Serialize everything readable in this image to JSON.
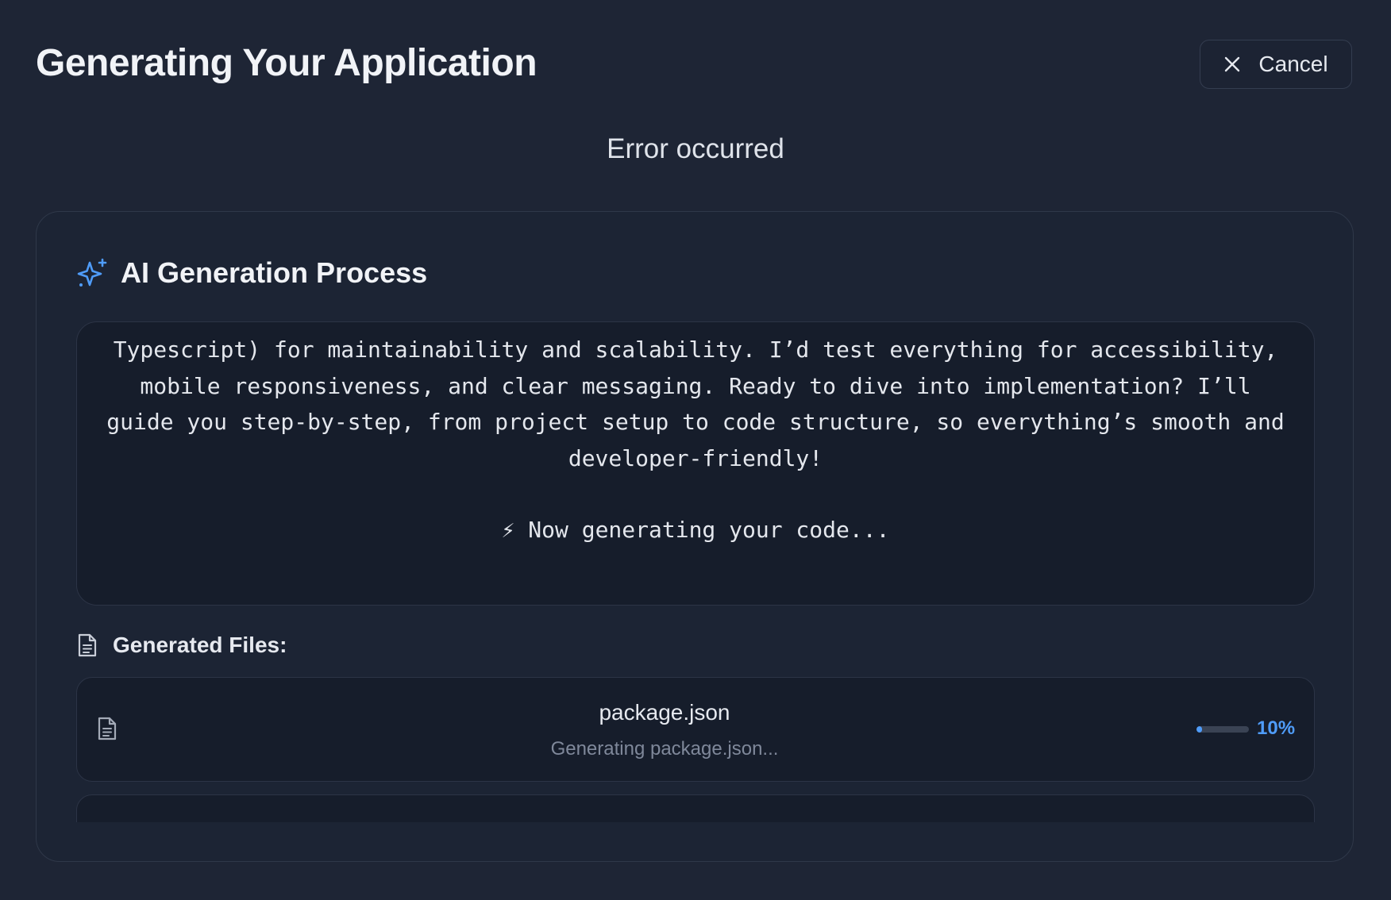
{
  "header": {
    "title": "Generating Your Application",
    "cancel_label": "Cancel",
    "cancel_icon": "close-icon"
  },
  "status_text": "Error occurred",
  "process": {
    "title": "AI Generation Process",
    "icon": "sparkles-icon",
    "log_text": "Typescript) for maintainability and scalability. I’d test everything for accessibility, mobile responsiveness, and clear messaging. Ready to dive into implementation? I’ll guide you step-by-step, from project setup to code structure, so everything’s smooth and developer-friendly!",
    "log_status": "⚡ Now generating your code..."
  },
  "files": {
    "title": "Generated Files:",
    "icon": "document-icon",
    "items": [
      {
        "name": "package.json",
        "status": "Generating package.json...",
        "progress": 10,
        "progress_label": "10%"
      }
    ]
  },
  "colors": {
    "background": "#1e2535",
    "card": "#1c2434",
    "panel": "#161d2b",
    "accent": "#4f9cf9"
  }
}
